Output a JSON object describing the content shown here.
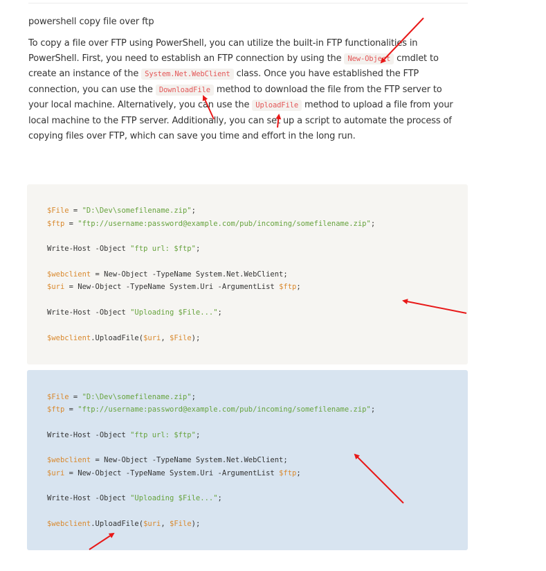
{
  "question": {
    "title": "powershell copy file over ftp"
  },
  "answer": {
    "p1": "To copy a file over FTP using PowerShell, you can utilize the built-in FTP functionalities in PowerShell. First, you need to establish an FTP connection by using the ",
    "code1": "New-Object",
    "p2": " cmdlet to create an instance of the ",
    "code2": "System.Net.WebClient",
    "p3": " class. Once you have established the FTP connection, you can use the ",
    "code3": "DownloadFile",
    "p4": " method to download the file from the FTP server to your local machine. Alternatively, you can use the ",
    "code4": "UploadFile",
    "p5": " method to upload a file from your local machine to the FTP server. Additionally, you can set up a script to automate the process of copying files over FTP, which can save you time and effort in the long run."
  },
  "code": {
    "l1_var": "$File",
    "l1_op": " = ",
    "l1_str": "\"D:\\Dev\\somefilename.zip\"",
    "l1_end": ";",
    "l2_var": "$ftp",
    "l2_op": " = ",
    "l2_str": "\"ftp://username:password@example.com/pub/incoming/somefilename.zip\"",
    "l2_end": ";",
    "l3_cmd": "Write-Host -Object ",
    "l3_str": "\"ftp url: $ftp\"",
    "l3_end": ";",
    "l4_var": "$webclient",
    "l4_rest": " = New-Object -TypeName System.Net.WebClient;",
    "l5_var": "$uri",
    "l5_rest": " = New-Object -TypeName System.Uri -ArgumentList ",
    "l5_var2": "$ftp",
    "l5_end": ";",
    "l6_cmd": "Write-Host -Object ",
    "l6_str": "\"Uploading $File...\"",
    "l6_end": ";",
    "l7_var": "$webclient",
    "l7_mid": ".UploadFile(",
    "l7_var2": "$uri",
    "l7_sep": ", ",
    "l7_var3": "$File",
    "l7_end": ");"
  },
  "colors": {
    "arrow": "#e81818",
    "code_bg_1": "#f6f5f2",
    "code_bg_2": "#d8e4f0",
    "inline_code": "#e35757",
    "variable": "#d9892e",
    "string": "#67a33e"
  }
}
